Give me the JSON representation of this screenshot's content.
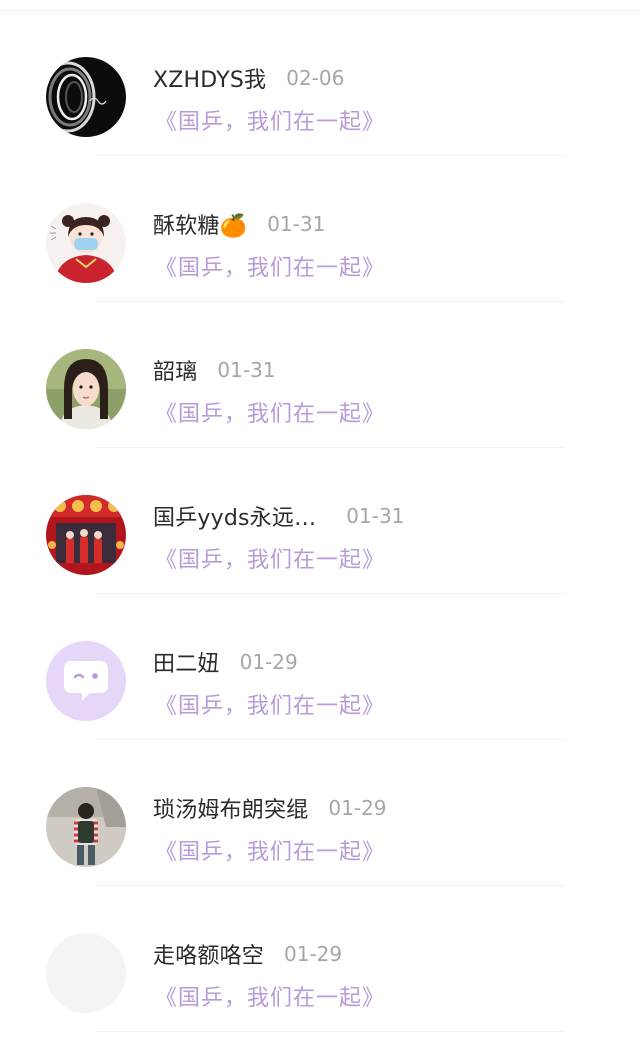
{
  "list": {
    "items": [
      {
        "name": "XZHDYS我",
        "date": "02-06",
        "message": "《国乒，我们在一起》",
        "avatar_icon": "dark-spiral-avatar"
      },
      {
        "name": "酥软糖🍊",
        "date": "01-31",
        "message": "《国乒，我们在一起》",
        "avatar_icon": "cartoon-girl-avatar"
      },
      {
        "name": "韶璃",
        "date": "01-31",
        "message": "《国乒，我们在一起》",
        "avatar_icon": "portrait-girl-avatar"
      },
      {
        "name": "国乒yyds永远…",
        "date": "01-31",
        "message": "《国乒，我们在一起》",
        "avatar_icon": "red-team-photo-avatar"
      },
      {
        "name": "田二妞",
        "date": "01-29",
        "message": "《国乒，我们在一起》",
        "avatar_icon": "default-chat-bubble-avatar"
      },
      {
        "name": "琐汤姆布朗突绲",
        "date": "01-29",
        "message": "《国乒，我们在一起》",
        "avatar_icon": "backpack-person-avatar"
      },
      {
        "name": "走咯额咯空",
        "date": "01-29",
        "message": "《国乒，我们在一起》",
        "avatar_icon": "blank-avatar"
      }
    ]
  },
  "colors": {
    "name": "#2b2b2b",
    "date": "#a6a6aa",
    "message_accent": "#b79ad8",
    "default_avatar_bg": "#e6d6f7"
  }
}
